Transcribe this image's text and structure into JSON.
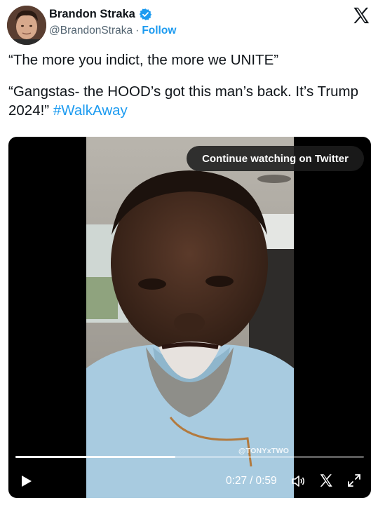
{
  "author": {
    "name": "Brandon Straka",
    "handle": "@BrandonStraka",
    "separator": "·",
    "follow_label": "Follow"
  },
  "icons": {
    "verified": "verified-badge-icon",
    "brand": "x-logo-icon",
    "play": "play-icon",
    "volume": "volume-icon",
    "fullscreen": "fullscreen-icon"
  },
  "colors": {
    "accent": "#1d9bf0",
    "text": "#0f1419",
    "muted": "#536471"
  },
  "tweet": {
    "line1": "“The more you indict, the more we UNITE”",
    "line2": "“Gangstas- the HOOD’s got this man’s back. It’s Trump 2024!”",
    "hashtag": "#WalkAway"
  },
  "video": {
    "continue_label": "Continue watching on Twitter",
    "watermark": "@TONYxTWO",
    "current_time": "0:27",
    "time_separator": "/",
    "duration": "0:59",
    "progress_fraction": 0.458
  }
}
